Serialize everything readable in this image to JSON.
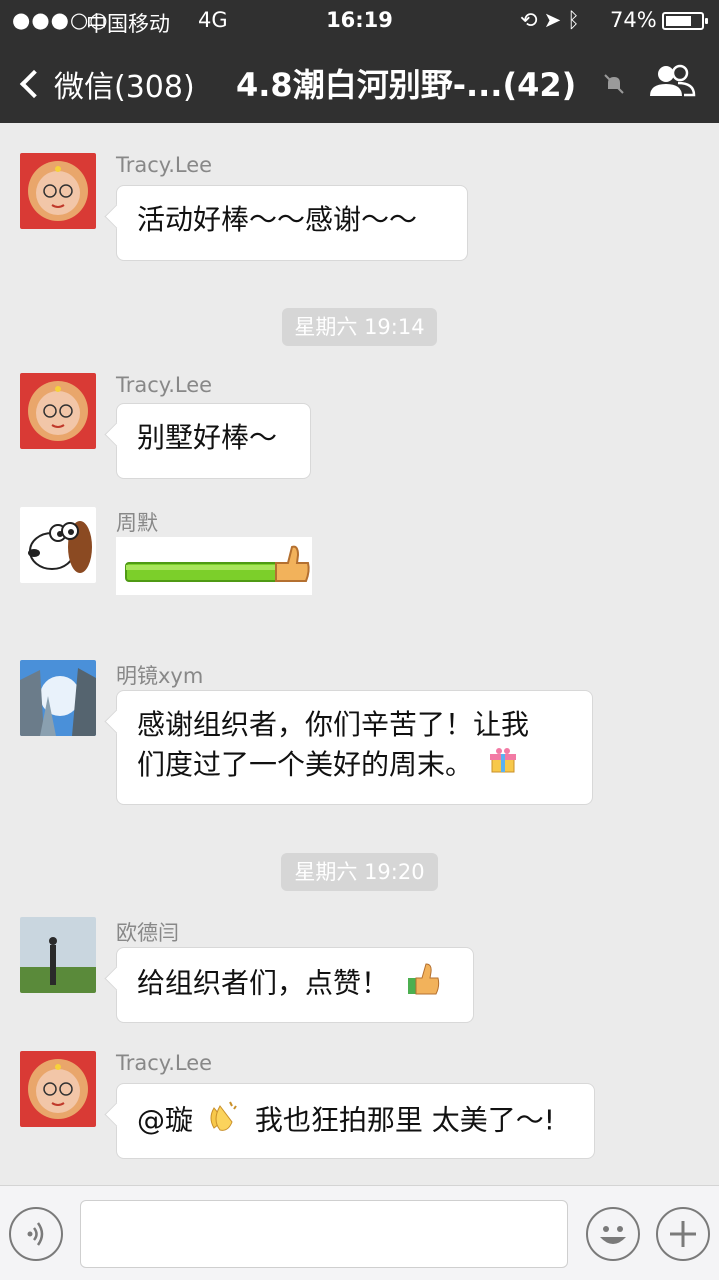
{
  "status_bar": {
    "signal": "●●●○○",
    "carrier": "中国移动",
    "network": "4G",
    "time": "16:19",
    "battery_percent": "74%",
    "battery_level": 0.74
  },
  "nav": {
    "back_label": "微信(308)",
    "title": "4.8潮白河别野-...(42)",
    "mute_icon": "bell-muted-icon",
    "members_icon": "group-people-icon"
  },
  "messages": [
    {
      "sender": "Tracy.Lee",
      "text": "活动好棒～～感谢～～",
      "avatar": "tracy-avatar"
    },
    {
      "timestamp": "星期六 19:14"
    },
    {
      "sender": "Tracy.Lee",
      "text": "别墅好棒～",
      "avatar": "tracy-avatar"
    },
    {
      "sender": "周默",
      "sticker": "thumbs-up-bar-sticker",
      "avatar": "dog-avatar"
    },
    {
      "sender": "明镜xym",
      "text_line1": "感谢组织者，你们辛苦了！让我",
      "text_line2": "们度过了一个美好的周末。",
      "emoji": "gift-emoji",
      "avatar": "sky-buildings-avatar"
    },
    {
      "timestamp": "星期六 19:20"
    },
    {
      "sender": "欧德闫",
      "text": "给组织者们，点赞！",
      "emoji": "thumbs-up-emoji",
      "avatar": "landscape-avatar"
    },
    {
      "sender": "Tracy.Lee",
      "text_a": "@璇",
      "text_b": "我也狂拍那里 太美了～!",
      "emoji": "clapping-hands-emoji",
      "avatar": "tracy-avatar"
    }
  ],
  "input_bar": {
    "voice_icon": "voice-icon",
    "emoji_icon": "smiley-icon",
    "plus_icon": "plus-icon"
  },
  "colors": {
    "nav_bg": "#303030",
    "chat_bg": "#ebebeb",
    "bubble_bg": "#ffffff",
    "timestamp_bg": "#d6d6d6"
  }
}
